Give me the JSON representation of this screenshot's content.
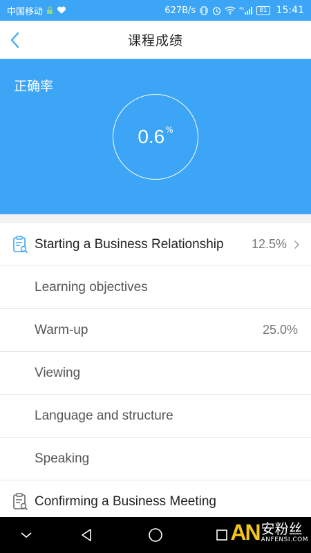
{
  "status_bar": {
    "carrier": "中国移动",
    "net_speed": "627B/s",
    "network_type": "4G",
    "battery": "81",
    "time": "15:41"
  },
  "header": {
    "title": "课程成绩"
  },
  "hero": {
    "label": "正确率",
    "rate_value": "0.6",
    "rate_unit": "%"
  },
  "list": {
    "rows": [
      {
        "type": "course",
        "title": "Starting a Business Relationship",
        "score": "12.5%"
      },
      {
        "type": "sub",
        "title": "Learning objectives",
        "score": ""
      },
      {
        "type": "sub",
        "title": "Warm-up",
        "score": "25.0%"
      },
      {
        "type": "sub",
        "title": "Viewing",
        "score": ""
      },
      {
        "type": "sub",
        "title": "Language and structure",
        "score": ""
      },
      {
        "type": "sub",
        "title": "Speaking",
        "score": ""
      },
      {
        "type": "course",
        "title": "Confirming a Business Meeting",
        "score": ""
      }
    ]
  },
  "watermark": {
    "logo": "AN",
    "cn": "安粉丝",
    "en": "ANFENSI.COM"
  },
  "colors": {
    "accent": "#3da5f5",
    "icon": "#3da5f5"
  },
  "icons": {
    "back": "chevron-left-icon",
    "course": "clipboard-search-icon",
    "chevron": "chevron-right-icon"
  }
}
